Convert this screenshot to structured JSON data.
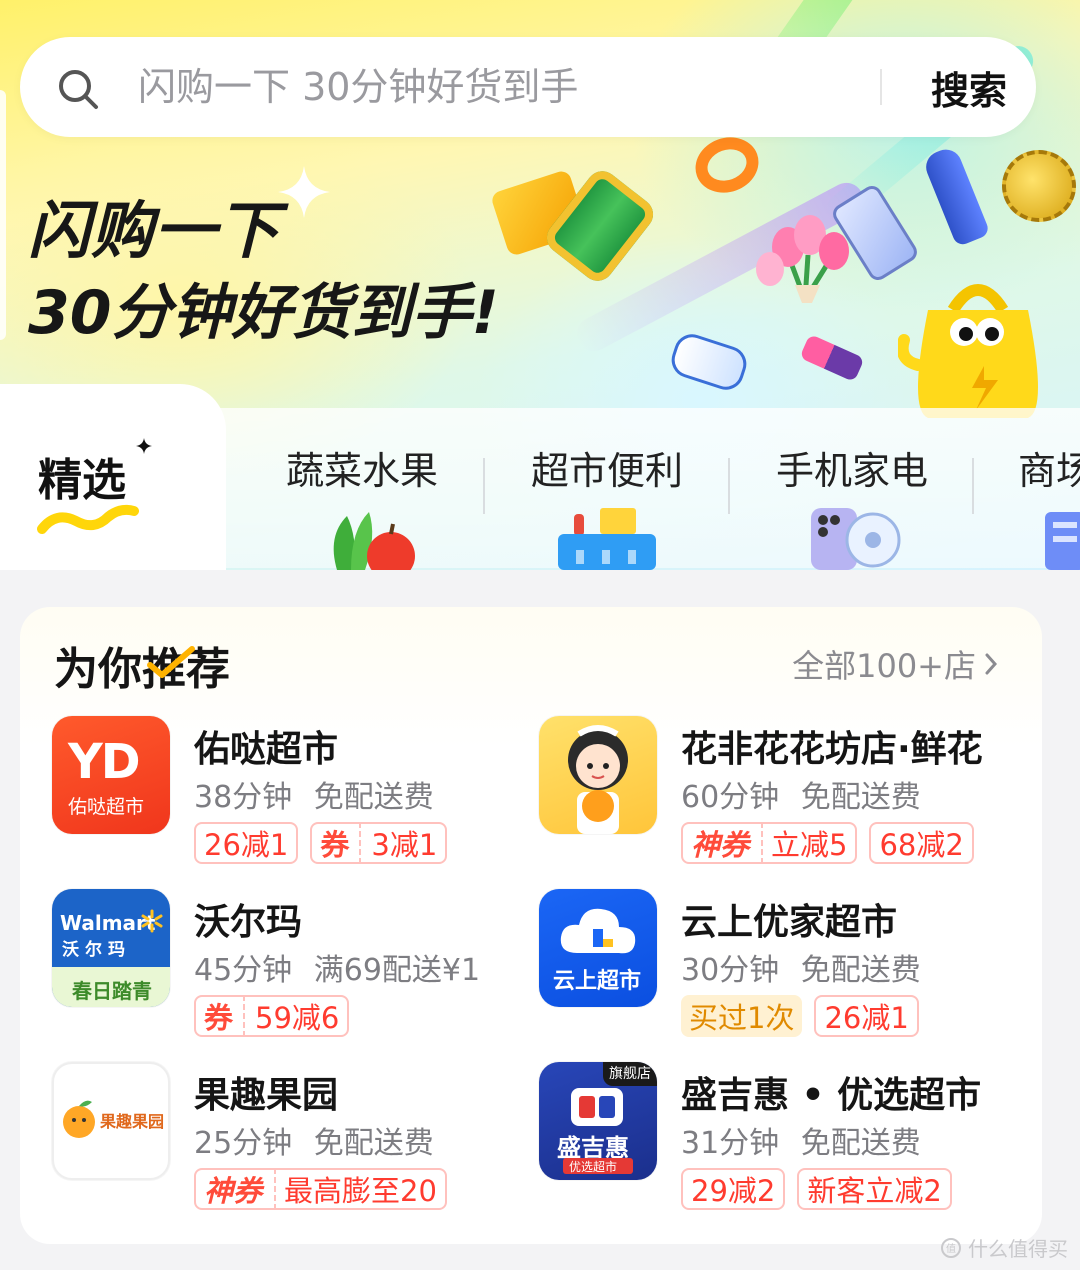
{
  "search": {
    "placeholder": "闪购一下 30分钟好货到手",
    "button_label": "搜索"
  },
  "hero": {
    "title_line1": "闪购一下",
    "title_line2": "30分钟好货到手!"
  },
  "categories": {
    "selected": "精选",
    "items": [
      {
        "label": "蔬菜水果",
        "icon": "vegetable-fruit-icon"
      },
      {
        "label": "超市便利",
        "icon": "shopping-basket-icon"
      },
      {
        "label": "手机家电",
        "icon": "phone-fan-icon"
      },
      {
        "label": "商场",
        "icon": "mall-building-icon"
      }
    ]
  },
  "recommend": {
    "title": "为你推荐",
    "all_link": "全部100+店",
    "stores": [
      {
        "name": "佑哒超市",
        "time": "38分钟",
        "delivery": "免配送费",
        "logo_text": "佑哒超市",
        "logo_mark": "YD",
        "tags": [
          {
            "text": "26减1"
          },
          {
            "prefix": "券",
            "text": "3减1"
          }
        ]
      },
      {
        "name": "花非花花坊店·鲜花",
        "time": "60分钟",
        "delivery": "免配送费",
        "tags": [
          {
            "prefix": "神券",
            "text": "立减5"
          },
          {
            "text": "68减2"
          }
        ]
      },
      {
        "name": "沃尔玛",
        "time": "45分钟",
        "delivery": "满69配送¥1",
        "logo_text_en": "Walmart",
        "logo_text_cn": "沃尔玛",
        "logo_sub": "春日踏青",
        "tags": [
          {
            "prefix": "券",
            "text": "59减6"
          }
        ]
      },
      {
        "name": "云上优家超市",
        "time": "30分钟",
        "delivery": "免配送费",
        "logo_text": "云上超市",
        "tags": [
          {
            "text": "买过1次",
            "kind": "bought"
          },
          {
            "text": "26减1"
          }
        ]
      },
      {
        "name": "果趣果园",
        "time": "25分钟",
        "delivery": "免配送费",
        "logo_text": "果趣果园",
        "tags": [
          {
            "prefix": "神券",
            "text": "最高膨至20"
          }
        ]
      },
      {
        "name": "盛吉惠 • 优选超市",
        "time": "31分钟",
        "delivery": "免配送费",
        "logo_text": "盛吉惠",
        "logo_badge": "旗舰店",
        "logo_sub": "优选超市",
        "tags": [
          {
            "text": "29减2"
          },
          {
            "text": "新客立减2"
          }
        ]
      }
    ]
  },
  "watermark": "什么值得买",
  "colors": {
    "accent_red": "#ff3b2f",
    "tag_border": "#ffc1bd",
    "hero_yellow": "#fff16a"
  }
}
